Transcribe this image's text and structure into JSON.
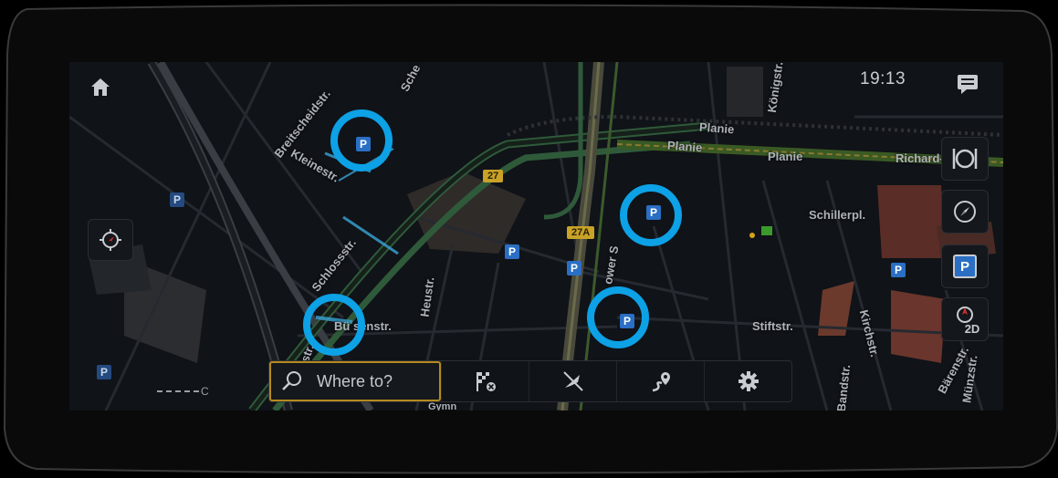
{
  "status_bar": {
    "time": "19:13"
  },
  "search": {
    "placeholder": "Where to?"
  },
  "map": {
    "road_labels": {
      "breitscheidstr": "Breitscheidstr.",
      "kleinestr": "Kleinestr.",
      "schlossstr": "Schlossstr.",
      "heustr": "Heustr.",
      "buesenstr": "Bü senstr.",
      "planie_top": "Planie",
      "planie_mid": "Planie",
      "planie_right": "Planie",
      "koenigstr": "Königstr.",
      "richard": "Richard-",
      "schillerpl": "Schillerpl.",
      "stiftstr": "Stiftstr.",
      "kirchstr": "Kirchstr.",
      "bandstr": "Bandstr.",
      "baerenstr": "Bärenstr.",
      "muenzstr": "Münzstr.",
      "gymn": "Gymn",
      "sche": "Sche",
      "lower": "ower S",
      "nnerstr": "hnerstr."
    },
    "route_badges": {
      "b27": "27",
      "b27a": "27A"
    },
    "parking_symbol": "P",
    "compass_mode": "2D",
    "scale_label": "C"
  },
  "icons": {
    "home": "home-icon",
    "message": "message-icon",
    "restaurant": "restaurant-icon",
    "compass": "compass-icon",
    "parking": "parking-icon",
    "heading": "heading-2d-icon",
    "locate": "locate-position-icon",
    "search": "search-icon",
    "destination": "destination-flag-icon",
    "mute": "mute-guidance-icon",
    "route": "route-icon",
    "settings": "gear-icon"
  },
  "colors": {
    "highlight": "#0da1e6",
    "search_border": "#b58a1e",
    "parking_blue": "#2a6fc4",
    "route_badge": "#c9a227"
  }
}
